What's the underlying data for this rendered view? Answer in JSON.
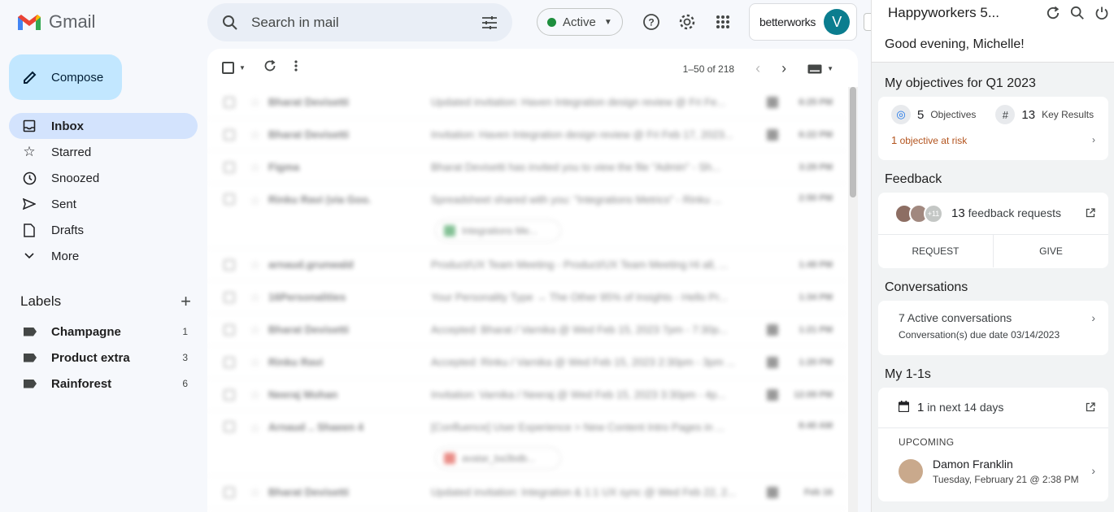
{
  "app": {
    "logo_text": "Gmail"
  },
  "compose": {
    "label": "Compose"
  },
  "nav": [
    {
      "label": "Inbox",
      "icon": "inbox-icon"
    },
    {
      "label": "Starred",
      "icon": "star-icon"
    },
    {
      "label": "Snoozed",
      "icon": "clock-icon"
    },
    {
      "label": "Sent",
      "icon": "send-icon"
    },
    {
      "label": "Drafts",
      "icon": "file-icon"
    },
    {
      "label": "More",
      "icon": "chevron-down-icon"
    }
  ],
  "labels": {
    "heading": "Labels",
    "items": [
      {
        "name": "Champagne",
        "count": "1"
      },
      {
        "name": "Product extra",
        "count": "3"
      },
      {
        "name": "Rainforest",
        "count": "6"
      }
    ]
  },
  "search": {
    "placeholder": "Search in mail"
  },
  "status": {
    "label": "Active",
    "color": "#1e8e3e"
  },
  "betterworks": {
    "brand": "betterworks",
    "avatar_letter": "V"
  },
  "toolbar": {
    "pager_text": "1–50 of 218"
  },
  "emails": [
    {
      "from": "Bharat Devisetti",
      "subject": "Updated invitation: Haven Integration design review @ Fri Fe...",
      "date": "6:25 PM",
      "calendar": true
    },
    {
      "from": "Bharat Devisetti",
      "subject": "Invitation: Haven Integration design review @ Fri Feb 17, 2023...",
      "date": "6:22 PM",
      "calendar": true
    },
    {
      "from": "Figma",
      "subject": "Bharat Devisetti has invited you to view the file \"Admin\" - Sh...",
      "date": "3:29 PM",
      "calendar": false
    },
    {
      "from": "Rinku Ravi (via Goo.",
      "subject": "Spreadsheet shared with you: \"Integrations Metrics\" - Rinku ...",
      "date": "2:50 PM",
      "calendar": false,
      "chip": "Integrations Me..."
    },
    {
      "from": "arnaud.grunwald",
      "subject": "Product/UX Team Meeting - Product/UX Team Meeting Hi all, ...",
      "date": "1:49 PM",
      "calendar": false
    },
    {
      "from": "16Personalities",
      "subject": "Your Personality Type → The Other 95% of Insights - Hello Pr...",
      "date": "1:34 PM",
      "calendar": false
    },
    {
      "from": "Bharat Devisetti",
      "subject": "Accepted: Bharat / Varnika @ Wed Feb 15, 2023 7pm - 7:30p...",
      "date": "1:21 PM",
      "calendar": true
    },
    {
      "from": "Rinku Ravi",
      "subject": "Accepted: Rinku / Varnika @ Wed Feb 15, 2023 2:30pm - 3pm ...",
      "date": "1:20 PM",
      "calendar": true
    },
    {
      "from": "Neeraj Mohan",
      "subject": "Invitation: Varnika / Neeraj @ Wed Feb 15, 2023 3:30pm - 4p...",
      "date": "12:09 PM",
      "calendar": true
    },
    {
      "from": "Arnaud .. Shaeen 4",
      "subject": "[Confluence] User Experience > New Content Intro Pages in ...",
      "date": "8:40 AM",
      "calendar": false,
      "chip": "avatar_ba3bdb..."
    },
    {
      "from": "Bharat Devisetti",
      "subject": "Updated invitation: Integration & 1:1 UX sync @ Wed Feb 22, 2...",
      "date": "Feb 16",
      "calendar": true
    }
  ],
  "panel": {
    "title": "Happyworkers 5...",
    "greeting": "Good evening, Michelle!",
    "objectives": {
      "heading": "My objectives for Q1 2023",
      "objectives_count": "5",
      "objectives_label": "Objectives",
      "key_results_count": "13",
      "key_results_label": "Key Results",
      "at_risk_count": "1",
      "at_risk_label": "objective at risk",
      "at_risk_color": "#b3541e"
    },
    "feedback": {
      "heading": "Feedback",
      "more_avatars": "+11",
      "requests_count": "13",
      "requests_label": "feedback requests",
      "request_button": "REQUEST",
      "give_button": "GIVE"
    },
    "conversations": {
      "heading": "Conversations",
      "active_text": "7 Active conversations",
      "due_text": "Conversation(s) due date 03/14/2023"
    },
    "one_on_ones": {
      "heading": "My 1-1s",
      "count": "1",
      "count_label": "in next 14 days",
      "upcoming_label": "UPCOMING",
      "person_name": "Damon Franklin",
      "meeting_time": "Tuesday, February 21 @ 2:38 PM"
    }
  }
}
